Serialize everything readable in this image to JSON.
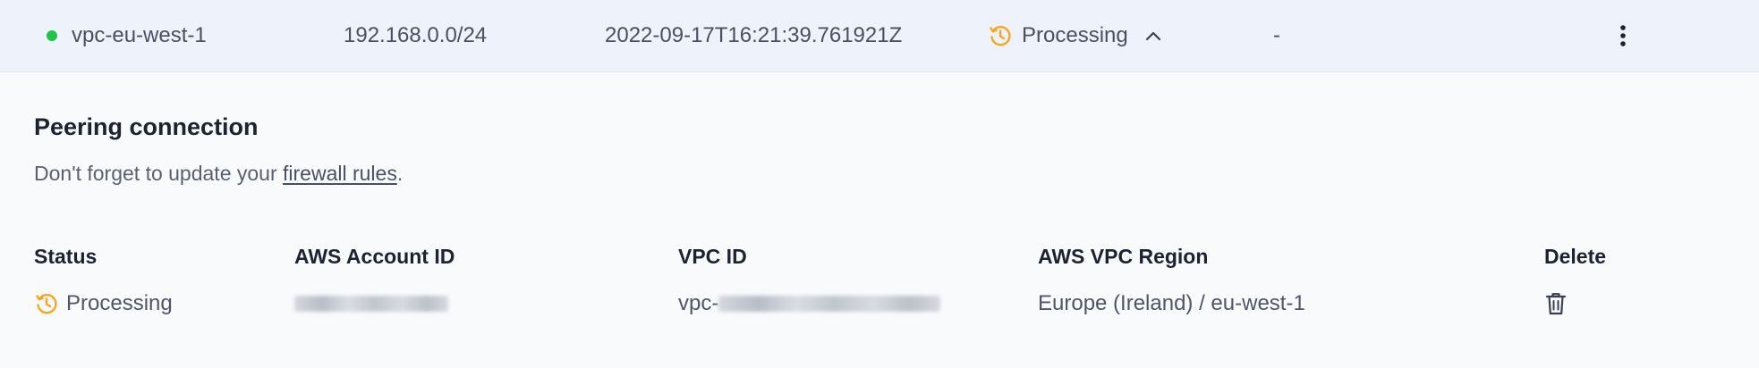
{
  "row": {
    "name": "vpc-eu-west-1",
    "cidr": "192.168.0.0/24",
    "timestamp": "2022-09-17T16:21:39.761921Z",
    "status": "Processing",
    "extra": "-",
    "status_dot_color": "#1fc44b",
    "status_color": "#f5a623"
  },
  "detail": {
    "title": "Peering connection",
    "hint_prefix": "Don't forget to update your ",
    "hint_link": "firewall rules",
    "hint_suffix": ".",
    "columns": {
      "status": "Status",
      "account": "AWS Account ID",
      "vpc": "VPC ID",
      "region": "AWS VPC Region",
      "delete": "Delete"
    },
    "values": {
      "status": "Processing",
      "vpc_prefix": "vpc-",
      "region": "Europe (Ireland) / eu-west-1"
    }
  },
  "icons": {
    "status": "clock-history-icon",
    "expand": "chevron-up-icon",
    "menu": "kebab-menu-icon",
    "delete": "trash-icon"
  }
}
